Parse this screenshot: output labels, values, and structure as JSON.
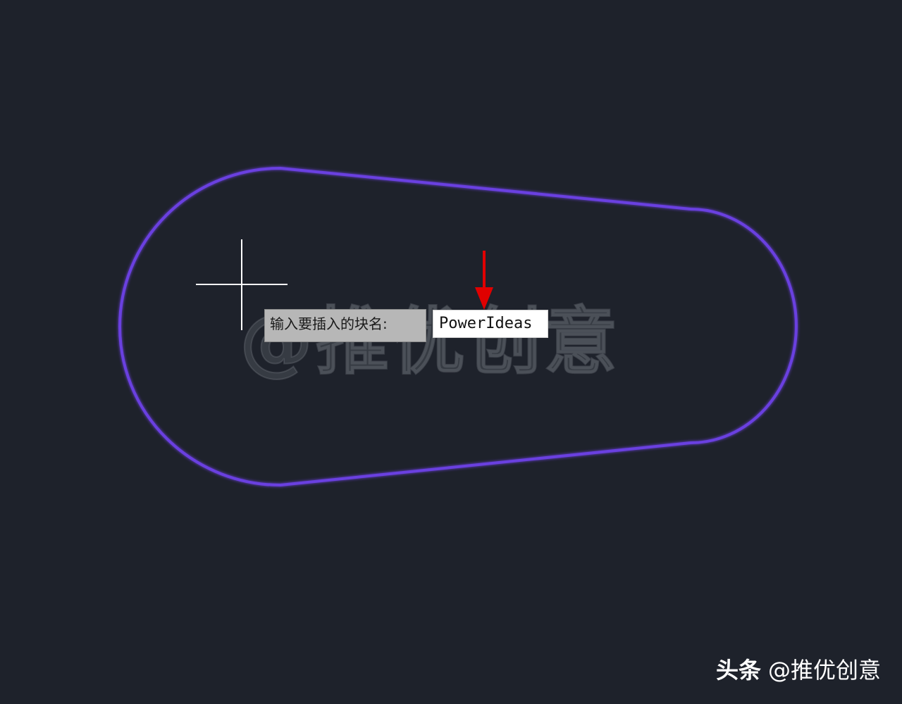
{
  "canvas": {
    "background_color": "#1e222b",
    "shape_color": "#6a3fe0",
    "crosshair_color": "#ffffff",
    "arrow_color": "#e00000"
  },
  "overlay_watermark": {
    "text": "@推优创意"
  },
  "command_prompt": {
    "label": "输入要插入的块名:",
    "input_value": "PowerIdeas"
  },
  "footer_watermark": {
    "brand": "头条",
    "handle": "@推优创意"
  }
}
